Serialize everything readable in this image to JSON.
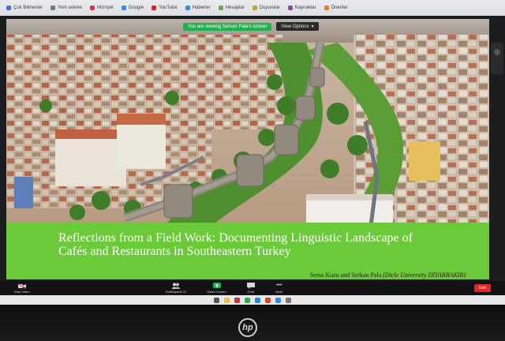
{
  "bookmarks": [
    {
      "label": "Çok Bilinenler",
      "color": "#3a77d8"
    },
    {
      "label": "Yeni sekme",
      "color": "#7a7a7a"
    },
    {
      "label": "Hürriyet",
      "color": "#d83a3a"
    },
    {
      "label": "Google",
      "color": "#4285f4"
    },
    {
      "label": "YouTube",
      "color": "#e62117"
    },
    {
      "label": "Haberler",
      "color": "#2d8ce0"
    },
    {
      "label": "Hesaplar",
      "color": "#6aa84f"
    },
    {
      "label": "Duyurular",
      "color": "#c9a227"
    },
    {
      "label": "Kaynaklar",
      "color": "#8e44ad"
    },
    {
      "label": "Öneriler",
      "color": "#e67e22"
    }
  ],
  "meeting": {
    "share_banner": "You are viewing Serkan Pala's screen",
    "view_options": "View Options",
    "controls": {
      "stop_video": "Stop Video",
      "participants": "Participants",
      "participants_count": "37",
      "share_screen": "Share Screen",
      "chat": "Chat",
      "more": "More",
      "end": "End"
    }
  },
  "slide": {
    "title_line1": "Reflections from a Field Work: Documenting Linguistic Landscape of",
    "title_line2": "Cafés and Restaurants in Southeastern Turkey",
    "authors": "Sema Kuzu and Serkan Pala",
    "affiliation": "(Dicle University DİYARBAKIR)"
  },
  "colors": {
    "slide_band": "#6cc93a",
    "share_green": "#23b14d",
    "end_red": "#e02828"
  },
  "taskbar": {
    "icons": [
      {
        "name": "search-icon",
        "color": "#555555"
      },
      {
        "name": "file-explorer-icon",
        "color": "#f0c040"
      },
      {
        "name": "opera-icon",
        "color": "#d32f2f"
      },
      {
        "name": "chrome-icon",
        "color": "#34a853"
      },
      {
        "name": "edge-icon",
        "color": "#1e88e5"
      },
      {
        "name": "powerpoint-icon",
        "color": "#d24726"
      },
      {
        "name": "zoom-icon",
        "color": "#2d8cff"
      },
      {
        "name": "settings-icon",
        "color": "#777777"
      }
    ]
  }
}
